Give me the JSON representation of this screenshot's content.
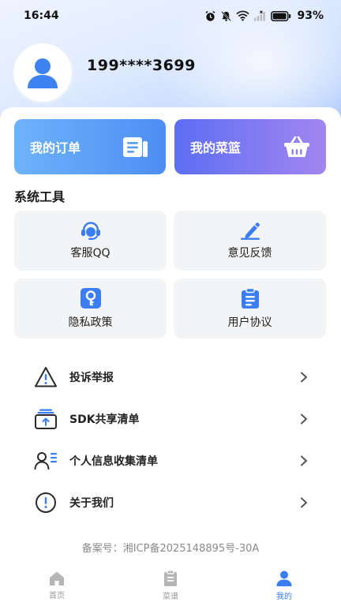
{
  "status_bar": {
    "time": "16:44",
    "battery": "93%"
  },
  "profile": {
    "phone": "199****3699"
  },
  "cards": {
    "orders_label": "我的订单",
    "basket_label": "我的菜篮"
  },
  "tools": {
    "title": "系统工具",
    "items": [
      {
        "label": "客服QQ",
        "icon": "headset-icon"
      },
      {
        "label": "意见反馈",
        "icon": "pencil-icon"
      },
      {
        "label": "隐私政策",
        "icon": "key-icon"
      },
      {
        "label": "用户协议",
        "icon": "clipboard-icon"
      }
    ]
  },
  "menu": {
    "items": [
      {
        "label": "投诉举报",
        "icon": "warning-icon"
      },
      {
        "label": "SDK共享清单",
        "icon": "share-box-icon"
      },
      {
        "label": "个人信息收集清单",
        "icon": "user-list-icon"
      },
      {
        "label": "关于我们",
        "icon": "info-icon"
      }
    ]
  },
  "footer": {
    "icp": "备案号：湘ICP备2025148895号-30A"
  },
  "tabbar": {
    "items": [
      {
        "label": "首页",
        "icon": "home-icon"
      },
      {
        "label": "菜谱",
        "icon": "recipe-icon"
      },
      {
        "label": "我的",
        "icon": "profile-icon"
      }
    ],
    "active_index": 2
  },
  "colors": {
    "accent": "#3b7df2",
    "orders_gradient": [
      "#6db3fb",
      "#4d8ef4"
    ],
    "basket_gradient": [
      "#5c6ef3",
      "#a286f0"
    ],
    "tool_bg": "#f3f4f6"
  }
}
